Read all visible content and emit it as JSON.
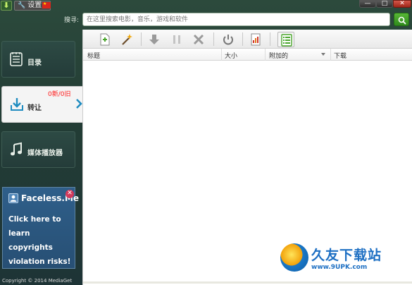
{
  "titlebar": {
    "settings_label": "设置",
    "flag_label": "中国",
    "minimize_label": "—",
    "maximize_label": "□",
    "close_label": "✕"
  },
  "search": {
    "label": "搜寻:",
    "placeholder": "在这里搜索电影，音乐，游戏和软件"
  },
  "sidebar": {
    "items": [
      {
        "label": "目录",
        "icon": "catalog-icon"
      },
      {
        "label": "转让",
        "icon": "download-tray-icon"
      },
      {
        "label": "媒体播放器",
        "icon": "music-note-icon"
      }
    ],
    "transfer_count": "0新/0旧"
  },
  "ad": {
    "title": "Faceless.Me",
    "text": "Click here to learn copyrights violation risks!"
  },
  "footer": {
    "copyright": "Copyright © 2014 MediaGet"
  },
  "toolbar": {
    "buttons": [
      "add-torrent-icon",
      "magic-wand-icon",
      "download-icon",
      "pause-icon",
      "delete-icon",
      "power-icon",
      "report-icon",
      "list-view-icon"
    ]
  },
  "table": {
    "columns": [
      "标题",
      "大小",
      "附加的",
      "下载"
    ]
  },
  "watermark": {
    "title": "久友下载站",
    "url": "www.9UPK.com"
  },
  "colors": {
    "accent_green": "#3a9a23",
    "new_count_red": "#ff1b1b",
    "ad_blue": "#2f5f8a"
  }
}
